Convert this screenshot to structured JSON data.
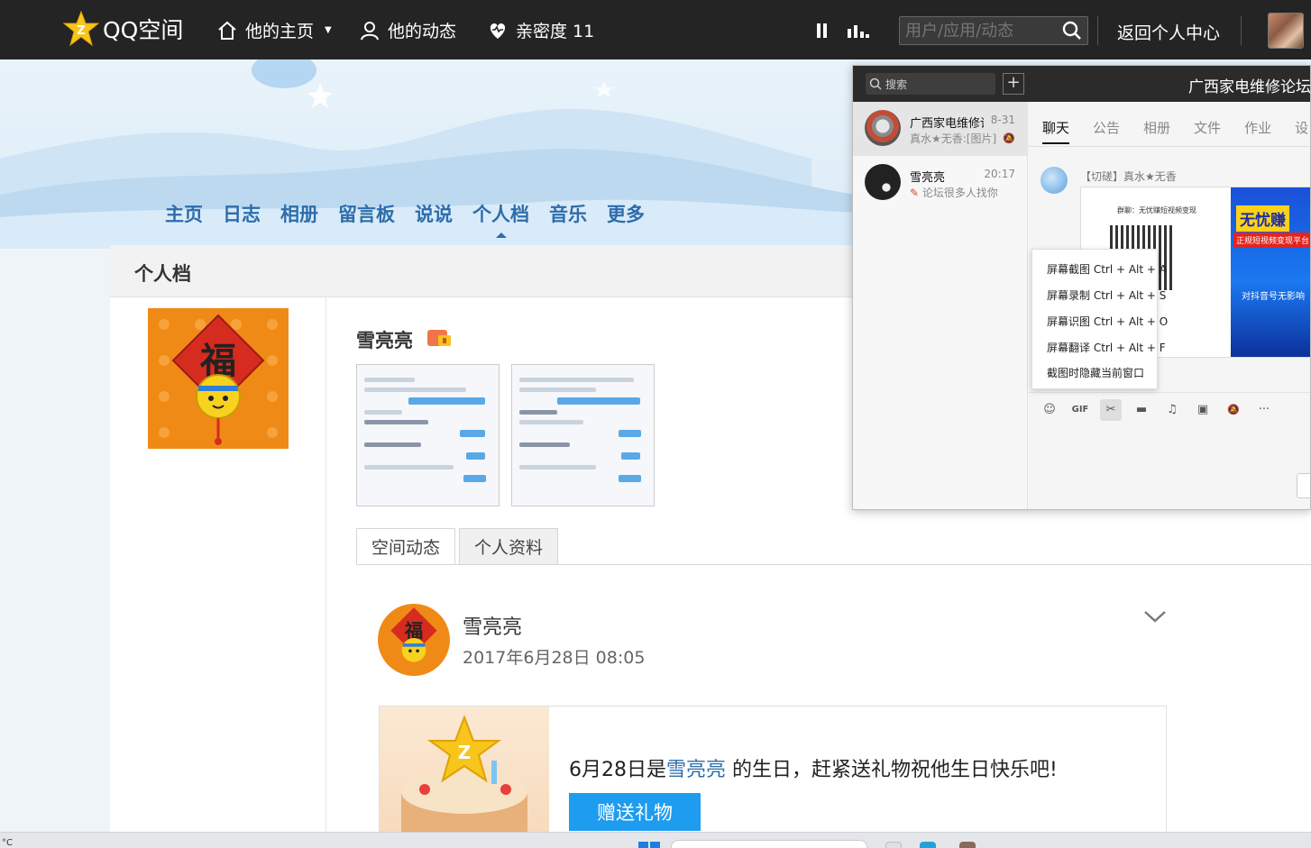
{
  "topbar": {
    "logo_text": "QQ空间",
    "nav": [
      {
        "label": "他的主页",
        "icon": "home-icon"
      },
      {
        "label": "他的动态",
        "icon": "user-icon"
      },
      {
        "label": "亲密度 11",
        "icon": "heart-icon"
      }
    ],
    "search_placeholder": "用户/应用/动态",
    "return_label": "返回个人中心"
  },
  "mainnav": [
    "主页",
    "日志",
    "相册",
    "留言板",
    "说说",
    "个人档",
    "音乐",
    "更多"
  ],
  "mainnav_active": "个人档",
  "section_title": "个人档",
  "profile": {
    "name": "雪亮亮",
    "avatar_char": "福"
  },
  "tabs": [
    "空间动态",
    "个人资料"
  ],
  "feed": {
    "name": "雪亮亮",
    "time": "2017年6月28日 08:05"
  },
  "birthday": {
    "prefix": "6月28日是",
    "name": "雪亮亮",
    "suffix": " 的生日，赶紧送礼物祝他生日快乐吧!",
    "button": "赠送礼物"
  },
  "qq_window": {
    "search_placeholder": "搜索",
    "title": "广西家电维修论坛",
    "contacts": [
      {
        "name": "广西家电维修论坛",
        "time": "8-31",
        "msg": "真水★无香:[图片]"
      },
      {
        "name": "雪亮亮",
        "time": "20:17",
        "msg": "论坛很多人找你"
      }
    ],
    "tabs": [
      "聊天",
      "公告",
      "相册",
      "文件",
      "作业",
      "设"
    ],
    "sender": "【切磋】真水★无香",
    "image_texts": {
      "group": "群聊：无忧赚短视频变现",
      "ad_title": "无忧赚",
      "ad_sub": "正规短视频变现平台",
      "ad_note": "对抖音号无影响"
    },
    "context_menu": [
      "屏幕截图 Ctrl + Alt + A",
      "屏幕录制 Ctrl + Alt + S",
      "屏幕识图 Ctrl + Alt + O",
      "屏幕翻译 Ctrl + Alt + F",
      "截图时隐藏当前窗口"
    ],
    "toolbar": [
      "☺",
      "GIF",
      "✂",
      "▬",
      "♫",
      "▣",
      "🔕",
      "···"
    ]
  },
  "taskbar": {
    "temp": "°C"
  }
}
